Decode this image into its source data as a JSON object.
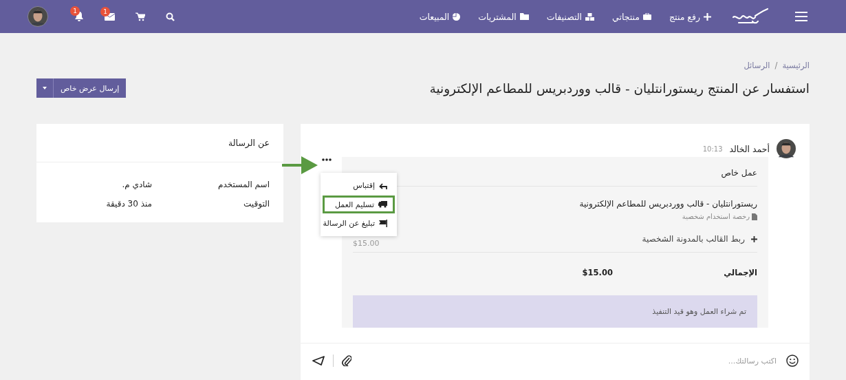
{
  "navbar": {
    "items": [
      {
        "kind": "upload",
        "label": "رفع منتج"
      },
      {
        "kind": "products",
        "label": "منتجاتي"
      },
      {
        "kind": "categories",
        "label": "التصنيفات"
      },
      {
        "kind": "purchases",
        "label": "المشتريات"
      },
      {
        "kind": "sales",
        "label": "المبيعات"
      }
    ],
    "actions": [
      {
        "kind": "search"
      },
      {
        "kind": "cart"
      },
      {
        "kind": "mail",
        "badge": "1"
      },
      {
        "kind": "bell",
        "badge": "1"
      }
    ]
  },
  "breadcrumb": {
    "items": [
      "الرئيسية",
      "الرسائل"
    ],
    "separator": "/"
  },
  "title": "استفسار عن المنتج ريستورانتليان - قالب ووردبريس للمطاعم الإلكترونية",
  "offer_button": "إرسال عرض خاص",
  "message": {
    "sender": "أحمد الخالد",
    "time": "10:13",
    "heading": "عمل خاص",
    "product": {
      "name": "ريستورانتليان - قالب ووردبريس للمطاعم الإلكترونية",
      "license": "رخصة استخدام شخصية"
    },
    "extra": {
      "name": "ربط القالب بالمدونة الشخصية",
      "price": "$15.00"
    },
    "total": {
      "label": "الإجمالي",
      "value": "$15.00"
    },
    "status": "تم شراء العمل وهو قيد التنفيذ"
  },
  "menu": [
    {
      "kind": "quote",
      "label": "إقتباس",
      "highlighted": false
    },
    {
      "kind": "deliver",
      "label": "تسليم العمل",
      "highlighted": true
    },
    {
      "kind": "report",
      "label": "تبليغ عن الرسالة",
      "highlighted": false
    }
  ],
  "composer": {
    "placeholder": "اكتب رسالتك..."
  },
  "sidebar": {
    "title": "عن الرسالة",
    "rows": [
      {
        "label": "اسم المستخدم",
        "value": "شادي م."
      },
      {
        "label": "التوقيت",
        "value": "منذ 30 دقيقة"
      }
    ]
  }
}
